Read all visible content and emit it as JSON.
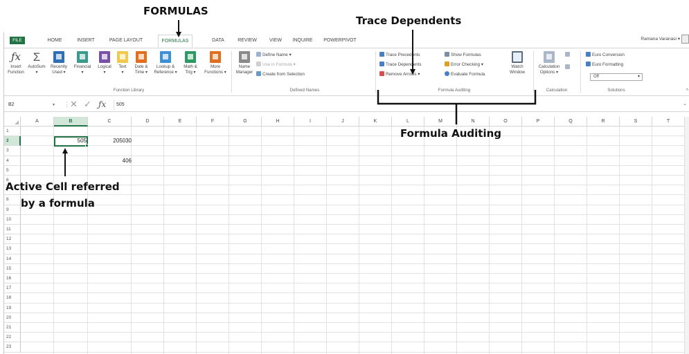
{
  "annotations": {
    "formulas": "FORMULAS",
    "trace_dependents": "Trace Dependents",
    "formula_auditing": "Formula Auditing",
    "active_cell_line1": "Active Cell referred",
    "active_cell_line2": "by a formula"
  },
  "tabs": [
    "FILE",
    "HOME",
    "INSERT",
    "PAGE LAYOUT",
    "FORMULAS",
    "DATA",
    "REVIEW",
    "VIEW",
    "INQUIRE",
    "POWERPIVOT"
  ],
  "active_tab": "FORMULAS",
  "user_name": "Ramana Varanasi ▾",
  "ribbon": {
    "function_library": {
      "label": "Function Library",
      "buttons": [
        {
          "line1": "Insert",
          "line2": "Function",
          "icon": "fx-icon"
        },
        {
          "line1": "AutoSum",
          "line2": "▾",
          "icon": "sigma-icon"
        },
        {
          "line1": "Recently",
          "line2": "Used ▾",
          "icon": "star-book-icon"
        },
        {
          "line1": "Financial",
          "line2": "▾",
          "icon": "financial-book-icon"
        },
        {
          "line1": "Logical",
          "line2": "▾",
          "icon": "logical-book-icon"
        },
        {
          "line1": "Text",
          "line2": "▾",
          "icon": "text-book-icon"
        },
        {
          "line1": "Date &",
          "line2": "Time ▾",
          "icon": "date-book-icon"
        },
        {
          "line1": "Lookup &",
          "line2": "Reference ▾",
          "icon": "lookup-book-icon"
        },
        {
          "line1": "Math &",
          "line2": "Trig ▾",
          "icon": "math-book-icon"
        },
        {
          "line1": "More",
          "line2": "Functions ▾",
          "icon": "more-functions-icon"
        }
      ]
    },
    "defined_names": {
      "label": "Defined Names",
      "name_manager": {
        "line1": "Name",
        "line2": "Manager"
      },
      "define_name": "Define Name ▾",
      "use_in_formula": "Use in Formula ▾",
      "create_from_selection": "Create from Selection"
    },
    "formula_auditing": {
      "label": "Formula Auditing",
      "trace_precedents": "Trace Precedents",
      "trace_dependents": "Trace Dependents",
      "remove_arrows": "Remove Arrows ▾",
      "show_formulas": "Show Formulas",
      "error_checking": "Error Checking ▾",
      "evaluate_formula": "Evaluate Formula",
      "watch_window": {
        "line1": "Watch",
        "line2": "Window"
      }
    },
    "calculation": {
      "label": "Calculation",
      "options": {
        "line1": "Calculation",
        "line2": "Options ▾"
      }
    },
    "solutions": {
      "label": "Solutions",
      "euro_conversion": "Euro Conversion",
      "euro_formatting": "Euro Formatting",
      "dropdown_value": "Off"
    }
  },
  "formula_bar": {
    "name_box": "B2",
    "value": "505"
  },
  "grid": {
    "columns": [
      "A",
      "B",
      "C",
      "D",
      "E",
      "F",
      "G",
      "H",
      "I",
      "J",
      "K",
      "L",
      "M",
      "N",
      "O",
      "P",
      "Q",
      "R",
      "S",
      "T"
    ],
    "rows": [
      "1",
      "2",
      "3",
      "4",
      "5",
      "6",
      "7",
      "8",
      "9",
      "10",
      "11",
      "12",
      "13",
      "14",
      "15",
      "16",
      "17",
      "18",
      "19",
      "20",
      "21",
      "22",
      "23"
    ],
    "active_cell": "B2",
    "cells": {
      "B2": "505",
      "C2": "205030",
      "C4": "406"
    }
  },
  "colors": {
    "excel_green": "#217346",
    "header_highlight": "#d2e6d9"
  }
}
